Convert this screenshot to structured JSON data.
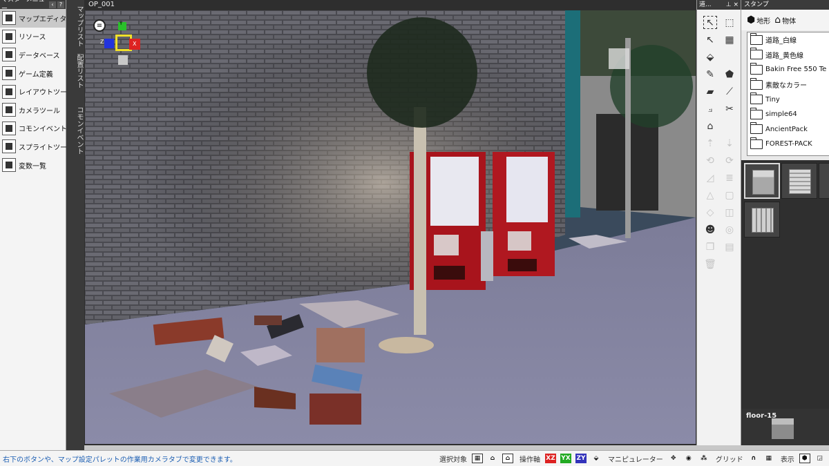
{
  "master_menu": {
    "title": "マスターメニュー",
    "collapse_icon": "chevron-left-icon",
    "help_label": "?",
    "items": [
      {
        "label": "マップエディター",
        "icon": "map-editor-icon",
        "active": true
      },
      {
        "label": "リソース",
        "icon": "resource-icon"
      },
      {
        "label": "データベース",
        "icon": "database-icon"
      },
      {
        "label": "ゲーム定義",
        "icon": "gamepad-icon"
      },
      {
        "label": "レイアウトツール",
        "icon": "layout-icon"
      },
      {
        "label": "カメラツール",
        "icon": "camera-icon"
      },
      {
        "label": "コモンイベント",
        "icon": "common-event-icon"
      },
      {
        "label": "スプライトツール",
        "icon": "sprite-icon"
      },
      {
        "label": "変数一覧",
        "icon": "variable-list-icon"
      }
    ]
  },
  "side_tabs": [
    "マップリスト",
    "配置リスト",
    "コモンイベント"
  ],
  "viewport": {
    "title": "OP_001",
    "gizmo": {
      "y": "Y",
      "z": "Z",
      "x": "X"
    }
  },
  "tools_panel": {
    "title": "道..."
  },
  "stamp_panel": {
    "title": "スタンプ",
    "tabs": [
      {
        "label": "地形",
        "icon": "terrain-cube-icon"
      },
      {
        "label": "物体",
        "icon": "house-icon"
      }
    ],
    "folders": [
      "道路_白線",
      "道路_黄色線",
      "Bakin Free 550 Te",
      "素敵なカラー",
      "Tiny",
      "simple64",
      "AncientPack",
      "FOREST-PACK"
    ],
    "preview_label": "floor-15"
  },
  "status_bar": {
    "hint": "右下のボタンや、マップ設定パレットの作業用カメラタブで変更できます。",
    "select_target_label": "選択対象",
    "operation_axis_label": "操作軸",
    "axis_xz": "XZ",
    "axis_yx": "YX",
    "axis_zy": "ZY",
    "manipulator_label": "マニピュレーター",
    "grid_label": "グリッド",
    "display_label": "表示"
  },
  "colors": {
    "panel_dark": "#3b3b3b",
    "hint_blue": "#1d5fb3",
    "axis_red": "#dd2222",
    "axis_green": "#22aa22",
    "axis_blue": "#3333bb"
  }
}
